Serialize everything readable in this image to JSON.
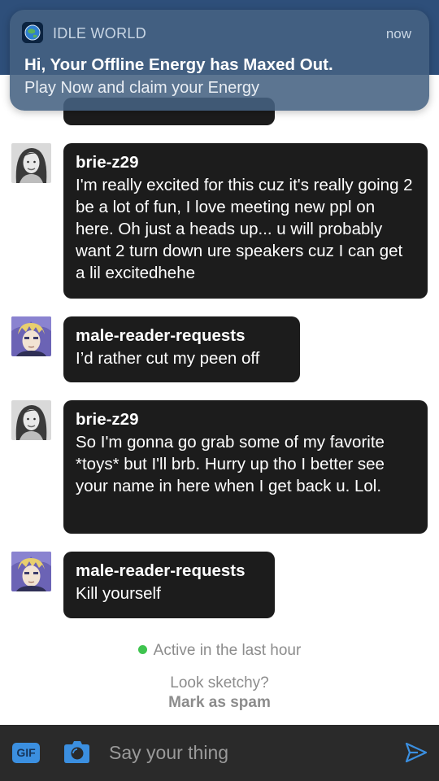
{
  "notification": {
    "app_name": "IDLE WORLD",
    "time": "now",
    "title": "Hi, Your Offline Energy has Maxed Out.",
    "body": "Play Now and claim your Energy"
  },
  "messages": [
    {
      "sender": "brie-z29",
      "avatar": "woman-avatar",
      "text": "I'm really excited for this cuz it's really going 2 be a lot of fun, I love meeting new ppl on here. Oh just a heads up... u will probably want 2 turn down ure speakers cuz I can get a lil excitedhehe"
    },
    {
      "sender": "male-reader-requests",
      "avatar": "anime-character-avatar",
      "text": "I’d rather cut my peen off"
    },
    {
      "sender": "brie-z29",
      "avatar": "woman-avatar",
      "text": "So I'm gonna go grab some of my favorite *toys* but I'll brb. Hurry up tho I better see your name in here when I get back u. Lol."
    },
    {
      "sender": "male-reader-requests",
      "avatar": "anime-character-avatar",
      "text": "Kill yourself"
    }
  ],
  "status": {
    "active_text": "Active in the last hour",
    "active_color": "#3fc44f"
  },
  "spam": {
    "question": "Look sketchy?",
    "link": "Mark as spam"
  },
  "composer": {
    "gif_label": "GIF",
    "placeholder": "Say your thing",
    "accent_color": "#3b8fe0"
  }
}
